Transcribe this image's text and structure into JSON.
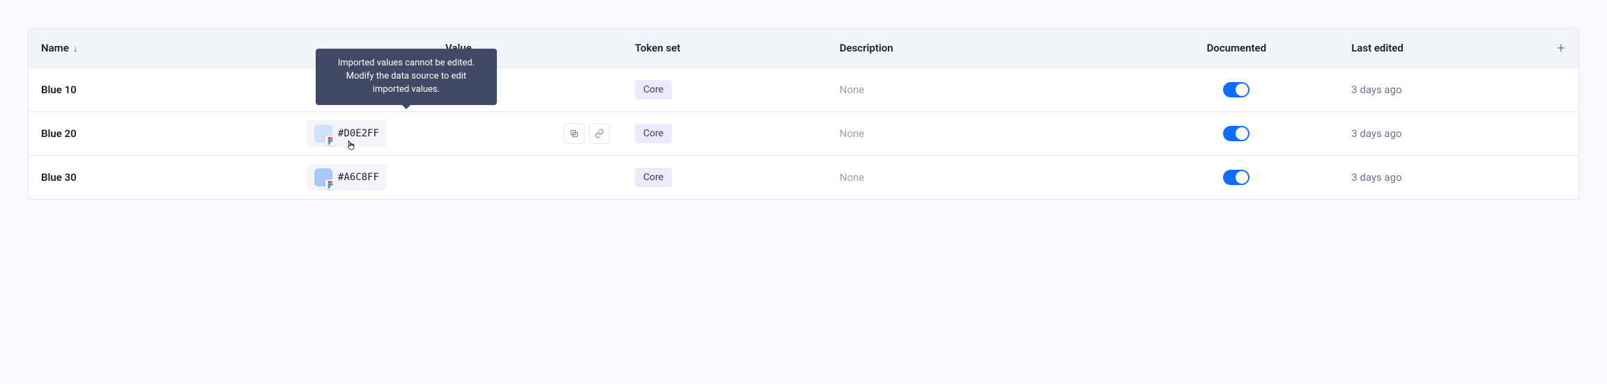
{
  "columns": {
    "name": "Name",
    "value": "Value",
    "token_set": "Token set",
    "description": "Description",
    "documented": "Documented",
    "last_edited": "Last edited"
  },
  "tooltip": "Imported values cannot be edited. Modify the data source to edit imported values.",
  "rows": [
    {
      "name": "Blue 10",
      "hex": "",
      "swatch": "#D0E2FF",
      "token_set": "Core",
      "description": "None",
      "documented": true,
      "last_edited": "3 days ago",
      "show_value": false,
      "show_actions": false,
      "show_tooltip": false
    },
    {
      "name": "Blue 20",
      "hex": "#D0E2FF",
      "swatch": "#D0E2FF",
      "token_set": "Core",
      "description": "None",
      "documented": true,
      "last_edited": "3 days ago",
      "show_value": true,
      "show_actions": true,
      "show_tooltip": true
    },
    {
      "name": "Blue 30",
      "hex": "#A6C8FF",
      "swatch": "#A6C8FF",
      "token_set": "Core",
      "description": "None",
      "documented": true,
      "last_edited": "3 days ago",
      "show_value": true,
      "show_actions": false,
      "show_tooltip": false
    }
  ]
}
